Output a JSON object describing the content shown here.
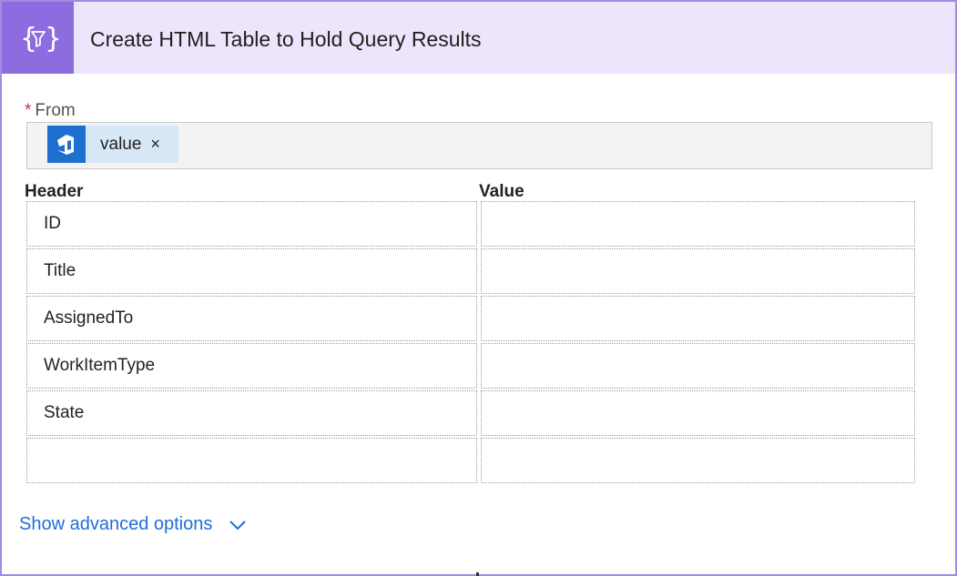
{
  "action": {
    "title": "Create HTML Table to Hold Query Results",
    "icon": "curly-braces-filter-icon"
  },
  "from": {
    "required_marker": "*",
    "label": "From",
    "token": {
      "label": "value",
      "icon": "azure-devops-icon",
      "remove_glyph": "×"
    }
  },
  "table": {
    "header_label": "Header",
    "value_label": "Value",
    "rows": [
      {
        "header": "ID",
        "value": ""
      },
      {
        "header": "Title",
        "value": ""
      },
      {
        "header": "AssignedTo",
        "value": ""
      },
      {
        "header": "WorkItemType",
        "value": ""
      },
      {
        "header": "State",
        "value": ""
      },
      {
        "header": "",
        "value": ""
      }
    ]
  },
  "advanced": {
    "label": "Show advanced options",
    "icon": "chevron-down-icon"
  },
  "colors": {
    "accent": "#8c6cde",
    "header_bg": "#ece5fc",
    "link": "#1e6ed8",
    "token_bg": "#d8e7f5",
    "devops_blue": "#1f6fd0"
  }
}
